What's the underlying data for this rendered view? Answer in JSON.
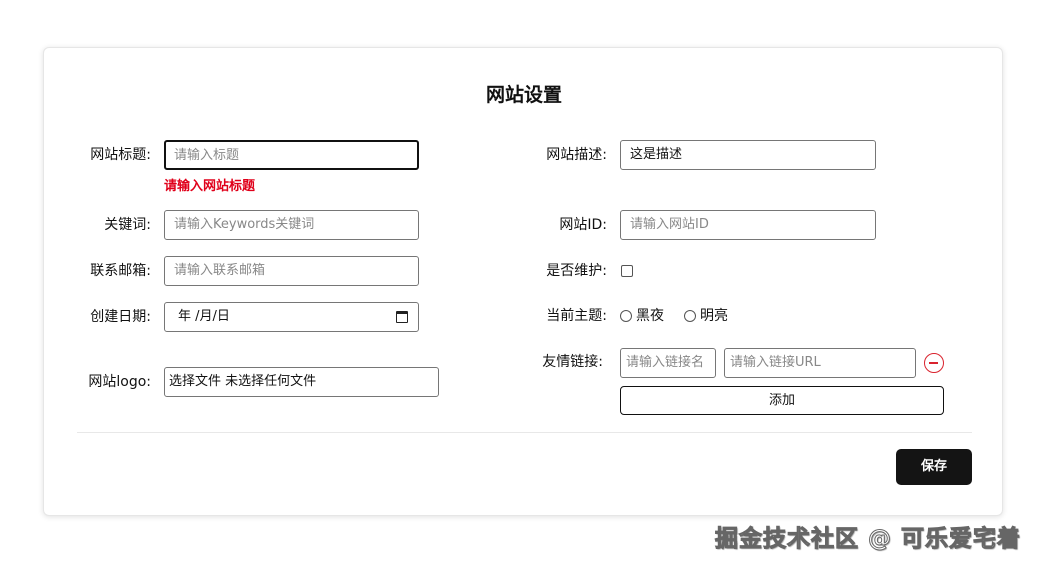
{
  "title": "网站设置",
  "left": {
    "site_title": {
      "label": "网站标题:",
      "placeholder": "请输入标题",
      "error": "请输入网站标题"
    },
    "keywords": {
      "label": "关键词:",
      "placeholder": "请输入Keywords关键词"
    },
    "email": {
      "label": "联系邮箱:",
      "placeholder": "请输入联系邮箱"
    },
    "date": {
      "label": "创建日期:",
      "value": "年 /月/日"
    },
    "logo": {
      "label": "网站logo:",
      "button": "选择文件",
      "status": "未选择任何文件"
    }
  },
  "right": {
    "description": {
      "label": "网站描述:",
      "value": "这是描述"
    },
    "site_id": {
      "label": "网站ID:",
      "placeholder": "请输入网站ID"
    },
    "maintenance": {
      "label": "是否维护:",
      "checked": false
    },
    "theme": {
      "label": "当前主题:",
      "options": [
        "黑夜",
        "明亮"
      ],
      "selected": null
    },
    "links": {
      "label": "友情链接:",
      "name_placeholder": "请输入链接名",
      "url_placeholder": "请输入链接URL",
      "add": "添加"
    }
  },
  "save": "保存",
  "watermark": "掘金技术社区 @ 可乐爱宅着",
  "colors": {
    "error": "#e0001a",
    "primary": "#141414"
  }
}
